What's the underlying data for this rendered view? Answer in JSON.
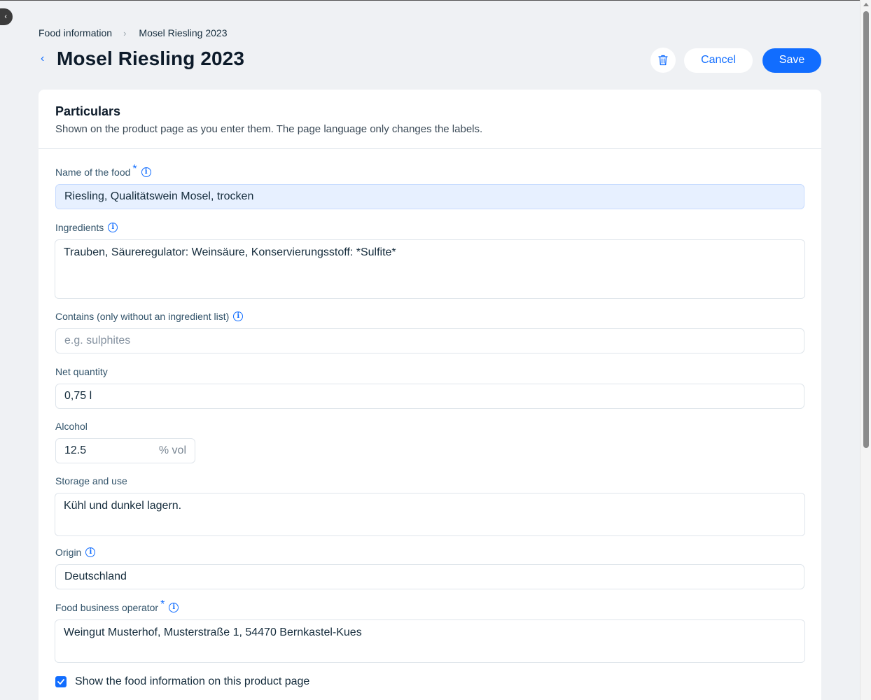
{
  "nav": {
    "collapse_icon": "‹"
  },
  "breadcrumb": {
    "parent": "Food information",
    "separator": "›",
    "current": "Mosel Riesling 2023"
  },
  "header": {
    "back_icon": "‹",
    "title": "Mosel Riesling 2023",
    "cancel_label": "Cancel",
    "save_label": "Save"
  },
  "card": {
    "title": "Particulars",
    "subtitle": "Shown on the product page as you enter them. The page language only changes the labels."
  },
  "fields": {
    "name": {
      "label": "Name of the food",
      "required": "*",
      "value": "Riesling, Qualitätswein Mosel, trocken"
    },
    "ingredients": {
      "label": "Ingredients",
      "value": "Trauben, Säureregulator: Weinsäure, Konservierungsstoff: *Sulfite*"
    },
    "contains": {
      "label": "Contains (only without an ingredient list)",
      "placeholder": "e.g. sulphites"
    },
    "net_quantity": {
      "label": "Net quantity",
      "value": "0,75 l"
    },
    "alcohol": {
      "label": "Alcohol",
      "value": "12.5",
      "suffix": "% vol"
    },
    "storage": {
      "label": "Storage and use",
      "value": "Kühl und dunkel lagern."
    },
    "origin": {
      "label": "Origin",
      "value": "Deutschland"
    },
    "operator": {
      "label": "Food business operator",
      "required": "*",
      "value": "Weingut Musterhof, Musterstraße 1, 54470 Bernkastel-Kues"
    }
  },
  "show_on_page": {
    "label": "Show the food information on this product page",
    "checked": true
  },
  "colors": {
    "accent": "#116dff",
    "background": "#eff1f4",
    "focused_input": "#e7f0ff"
  }
}
